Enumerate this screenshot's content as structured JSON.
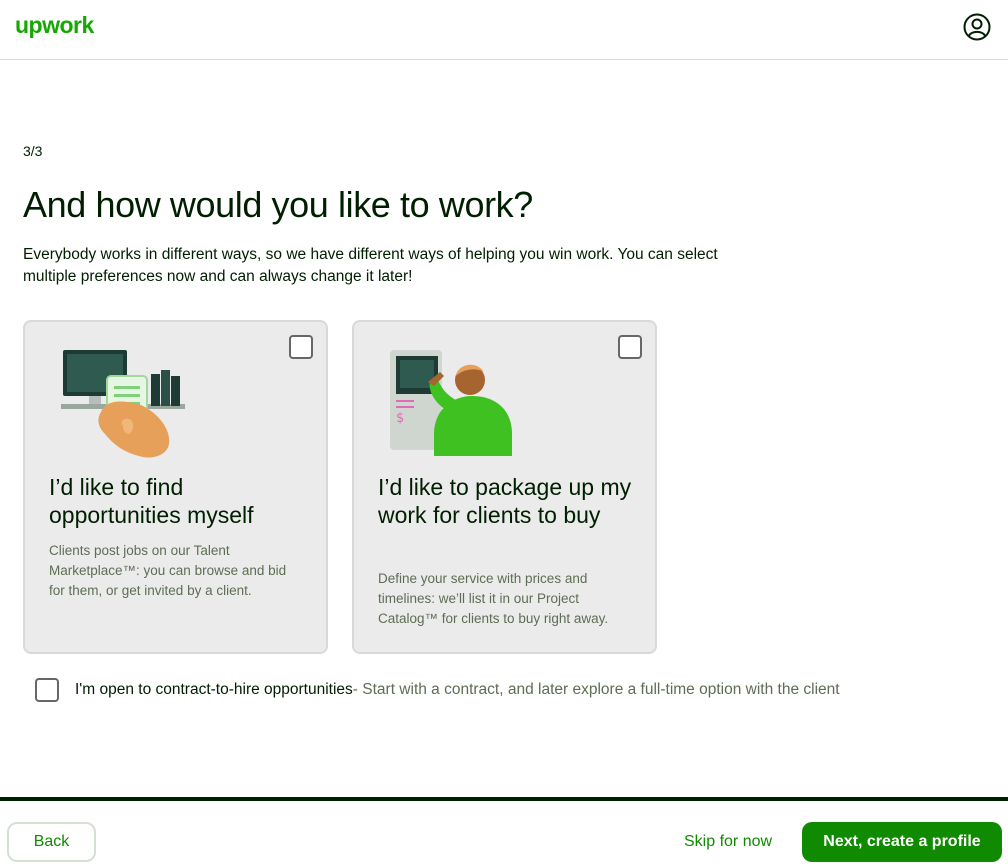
{
  "header": {
    "logo": "upwork",
    "avatar_icon": "user-circle-icon"
  },
  "step": "3/3",
  "title": "And how would you like to work?",
  "description": "Everybody works in different ways, so we have different ways of helping you win work. You can select multiple preferences now and can always change it later!",
  "cards": [
    {
      "title": "I’d like to find opportunities myself",
      "description": "Clients post jobs on our Talent Marketplace™: you can browse and bid for them, or get invited by a client.",
      "checked": false,
      "illustration": "hand-holding-phone-illustration"
    },
    {
      "title": "I’d like to package up my work for clients to buy",
      "description": "Define your service with prices and timelines: we’ll list it in our Project Catalog™ for clients to buy right away.",
      "checked": false,
      "illustration": "person-at-kiosk-illustration"
    }
  ],
  "contract_to_hire": {
    "label": "I'm open to contract-to-hire opportunities",
    "detail": " - Start with a contract, and later explore a full-time option with the client",
    "checked": false
  },
  "footer": {
    "back_label": "Back",
    "skip_label": "Skip for now",
    "next_label": "Next, create a profile"
  },
  "colors": {
    "brand": "#14a800",
    "button": "#108a00",
    "text": "#001e00",
    "muted": "#5e6d55"
  }
}
